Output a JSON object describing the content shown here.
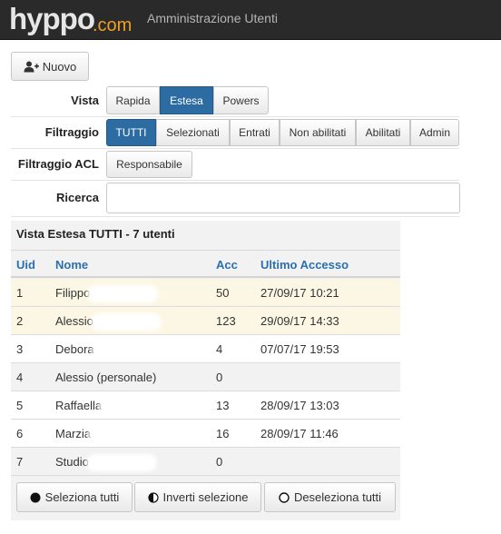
{
  "navbar": {
    "logo_main": "hyppo",
    "logo_sub": ".com",
    "title": "Amministrazione Utenti"
  },
  "toolbar": {
    "nuovo_label": "Nuovo"
  },
  "vista": {
    "label": "Vista",
    "options": [
      "Rapida",
      "Estesa",
      "Powers"
    ],
    "active": "Estesa"
  },
  "filtraggio": {
    "label": "Filtraggio",
    "options": [
      "TUTTI",
      "Selezionati",
      "Entrati",
      "Non abilitati",
      "Abilitati",
      "Admin"
    ],
    "active": "TUTTI"
  },
  "filtraggio_acl": {
    "label": "Filtraggio ACL",
    "option": "Responsabile"
  },
  "ricerca": {
    "label": "Ricerca",
    "value": "",
    "placeholder": ""
  },
  "table": {
    "title": "Vista Estesa TUTTI - 7 utenti",
    "columns": [
      "Uid",
      "Nome",
      "Acc",
      "Ultimo Accesso"
    ],
    "rows": [
      {
        "uid": "1",
        "nome": "Filippo",
        "acc": "50",
        "last": "27/09/17 10:21",
        "selected": true
      },
      {
        "uid": "2",
        "nome": "Alessio",
        "acc": "123",
        "last": "29/09/17 14:33",
        "selected": true
      },
      {
        "uid": "3",
        "nome": "Debora",
        "acc": "4",
        "last": "07/07/17 19:53",
        "selected": false
      },
      {
        "uid": "4",
        "nome": "Alessio (personale)",
        "acc": "0",
        "last": "",
        "selected": false
      },
      {
        "uid": "5",
        "nome": "Raffaella",
        "acc": "13",
        "last": "28/09/17 13:03",
        "selected": false
      },
      {
        "uid": "6",
        "nome": "Marzia",
        "acc": "16",
        "last": "28/09/17 11:46",
        "selected": false
      },
      {
        "uid": "7",
        "nome": "Studio",
        "acc": "0",
        "last": "",
        "selected": false
      }
    ]
  },
  "footer": {
    "select_all": "Seleziona tutti",
    "invert": "Inverti selezione",
    "deselect_all": "Deseleziona tutti"
  },
  "colors": {
    "navbar": "#2a2a2a",
    "primary": "#2d6ca2",
    "header_text": "#2a6fb0",
    "selected_row": "#fcf7e4",
    "logo_accent": "#f0a020"
  },
  "icons": {
    "nuovo": "user-plus-icon",
    "select_all": "filled-circle-icon",
    "invert": "half-circle-icon",
    "deselect_all": "empty-circle-icon"
  }
}
